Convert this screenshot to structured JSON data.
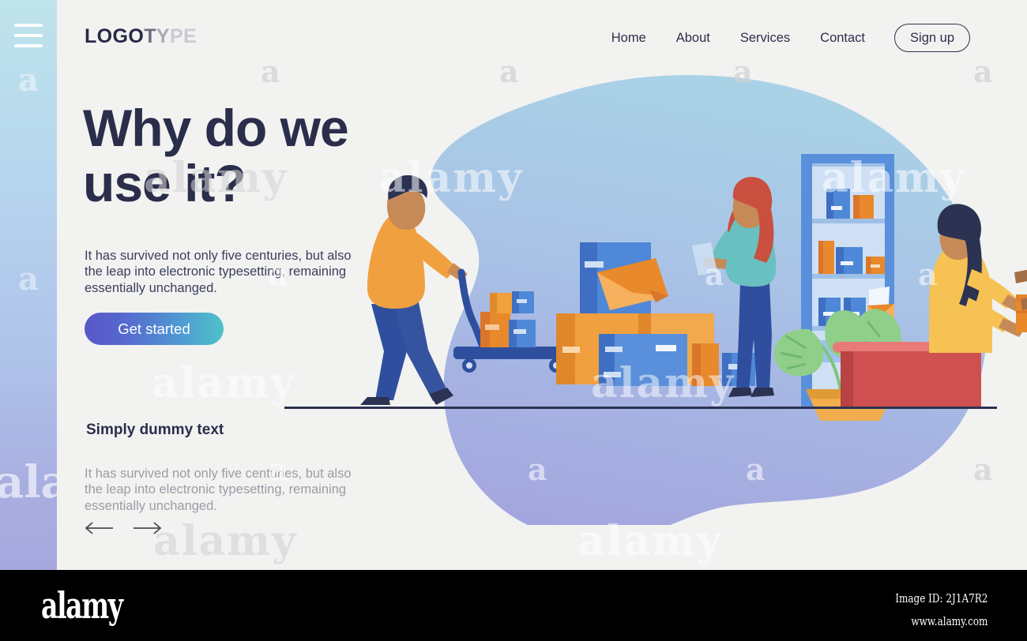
{
  "rail": {
    "menu_icon": "hamburger-menu-icon",
    "watermark": "a"
  },
  "header": {
    "logo": {
      "part1": "LOGO",
      "part2": "T",
      "part3": "Y",
      "part4": "PE"
    },
    "nav": [
      {
        "label": "Home"
      },
      {
        "label": "About"
      },
      {
        "label": "Services"
      },
      {
        "label": "Contact"
      }
    ],
    "signup_label": "Sign up"
  },
  "hero": {
    "heading_line1": "Why do we",
    "heading_line2": "use it?",
    "lead": "It has survived not only five centuries, but also the leap into electronic typesetting, remaining essentially unchanged.",
    "cta_label": "Get started"
  },
  "secondary": {
    "heading": "Simply dummy text",
    "body": "It has survived not only five centuries, but also the leap into electronic typesetting, remaining essentially unchanged.",
    "prev_icon": "arrow-left-icon",
    "next_icon": "arrow-right-icon"
  },
  "illustration": {
    "name": "warehouse-delivery-illustration",
    "scene_elements": [
      "worker-pushing-hand-truck",
      "stacked-parcel-boxes",
      "envelope-on-box",
      "woman-with-clipboard",
      "storage-shelf-with-boxes",
      "potted-monstera-plant",
      "reception-counter",
      "clerk-handing-parcel",
      "customer-receiving-parcel"
    ]
  },
  "watermarks": {
    "text_short": "a",
    "text_full": "alamy"
  },
  "footer": {
    "brand": "alamy",
    "image_id": "Image ID: 2J1A7R2",
    "website": "www.alamy.com"
  },
  "colors": {
    "page_bg": "#f2f2f1",
    "ink": "#2b2e4a",
    "blob_top": "#a7cfe6",
    "blob_bottom": "#a3a6dd",
    "accent_orange": "#f2a03c",
    "accent_blue": "#4f88d8",
    "accent_red": "#cf5050",
    "cta_from": "#5857c6",
    "cta_to": "#4ec2c9"
  }
}
